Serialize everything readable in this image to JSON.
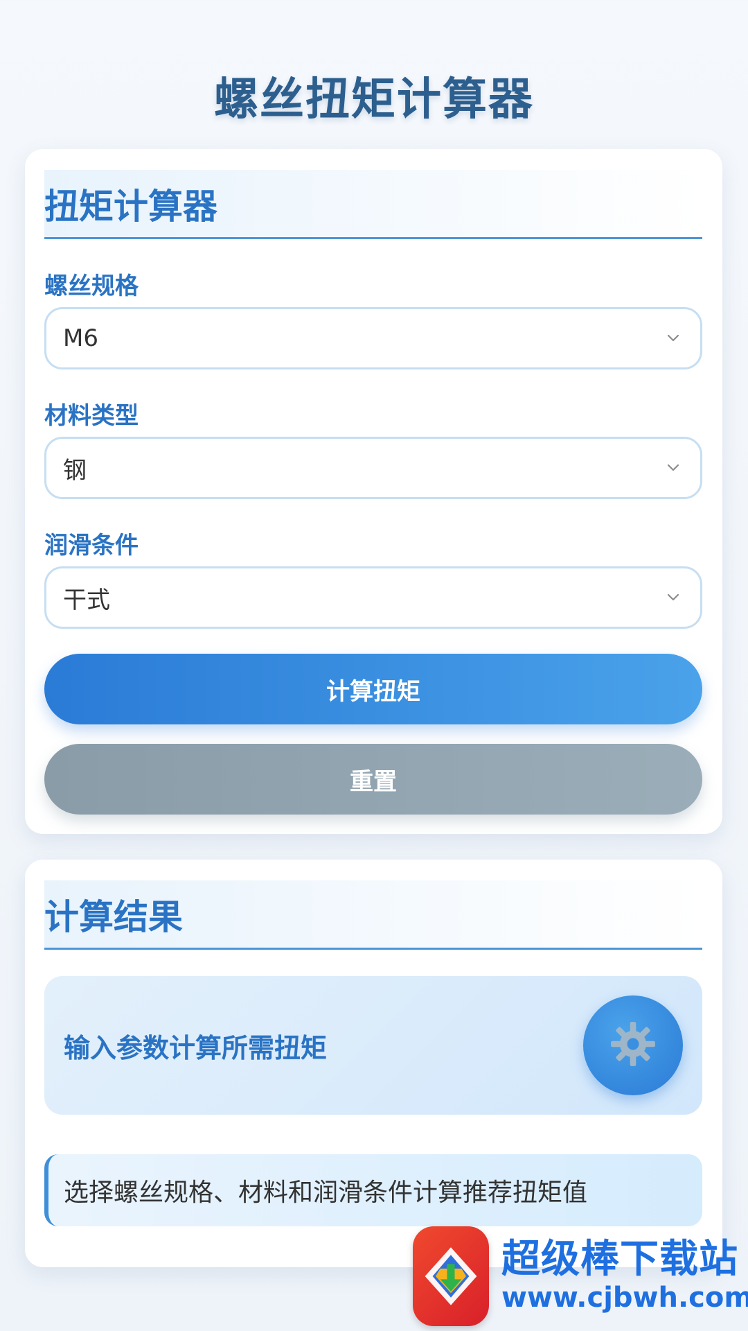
{
  "page": {
    "title": "螺丝扭矩计算器"
  },
  "calculator": {
    "heading": "扭矩计算器",
    "fields": [
      {
        "label": "螺丝规格",
        "value": "M6"
      },
      {
        "label": "材料类型",
        "value": "钢"
      },
      {
        "label": "润滑条件",
        "value": "干式"
      }
    ],
    "calculate_label": "计算扭矩",
    "reset_label": "重置"
  },
  "result": {
    "heading": "计算结果",
    "placeholder": "输入参数计算所需扭矩",
    "hint": "选择螺丝规格、材料和润滑条件计算推荐扭矩值"
  },
  "watermark": {
    "name": "超级棒下载站",
    "url": "www.cjbwh.com"
  },
  "icons": {
    "select_arrow": "chevron-down-icon",
    "result_badge": "gear-icon",
    "watermark_logo": "download-logo-icon"
  },
  "colors": {
    "accent": "#2a7bd6",
    "title": "#2d5f8e",
    "secondary_button": "#8a9ca8"
  }
}
